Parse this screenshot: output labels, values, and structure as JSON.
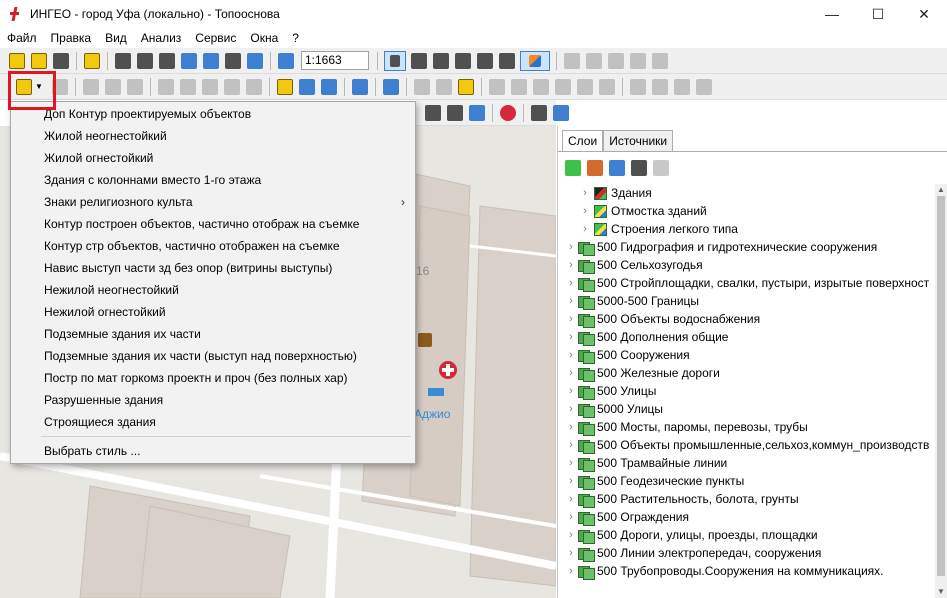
{
  "window": {
    "title": "ИНГЕО - город Уфа (локально) - Топооснова",
    "minimize": "—",
    "maximize": "☐",
    "close": "✕"
  },
  "menu": [
    "Файл",
    "Правка",
    "Вид",
    "Анализ",
    "Сервис",
    "Окна",
    "?"
  ],
  "toolbar": {
    "scale_value": "1:1663"
  },
  "dropdown": {
    "items": [
      "Доп Контур проектируемых объектов",
      "Жилой неогнестойкий",
      "Жилой огнестойкий",
      "Здания с колоннами вместо 1-го этажа",
      "Знаки религиозного культа",
      "Контур построен объектов, частично отображ на съемке",
      "Контур стр объектов, частично отображен на съемке",
      "Навис выступ части зд без опор (витрины выступы)",
      "Нежилой неогнестойкий",
      "Нежилой огнестойкий",
      "Подземные здания их части",
      "Подземные здания их части (выступ над поверхностью)",
      "Постр по мат горкомз проектн и проч (без полных хар)",
      "Разрушенные здания",
      "Строящиеся здания"
    ],
    "submenu_arrow": "›",
    "footer": "Выбрать стиль ..."
  },
  "map": {
    "house_number": "16",
    "poi_label": "Аджио"
  },
  "panel": {
    "tabs": [
      "Слои",
      "Источники"
    ],
    "active_tab": "Слои",
    "layers": [
      {
        "label": "Здания",
        "level": 1
      },
      {
        "label": "Отмостка зданий",
        "level": 1
      },
      {
        "label": "Строения легкого типа",
        "level": 1
      },
      {
        "label": "500 Гидрография и гидротехнические сооружения",
        "level": 0
      },
      {
        "label": "500 Сельхозугодья",
        "level": 0
      },
      {
        "label": "500 Стройплощадки, свалки, пустыри, изрытые поверхност",
        "level": 0
      },
      {
        "label": "5000-500 Границы",
        "level": 0
      },
      {
        "label": "500 Объекты водоснабжения",
        "level": 0
      },
      {
        "label": "500 Дополнения общие",
        "level": 0
      },
      {
        "label": "500 Сооружения",
        "level": 0
      },
      {
        "label": "500 Железные дороги",
        "level": 0
      },
      {
        "label": "500 Улицы",
        "level": 0
      },
      {
        "label": "5000 Улицы",
        "level": 0
      },
      {
        "label": "500 Мосты, паромы, перевозы, трубы",
        "level": 0
      },
      {
        "label": "500 Объекты промышленные,сельхоз,коммун_производств",
        "level": 0
      },
      {
        "label": "500 Трамвайные линии",
        "level": 0
      },
      {
        "label": "500 Геодезические пункты",
        "level": 0
      },
      {
        "label": "500 Растительность, болота, грунты",
        "level": 0
      },
      {
        "label": "500 Ограждения",
        "level": 0
      },
      {
        "label": "500 Дороги, улицы, проезды, площадки",
        "level": 0
      },
      {
        "label": "500 Линии электропередач, сооружения",
        "level": 0
      },
      {
        "label": "500 Трубопроводы.Сооружения на коммуникациях.",
        "level": 0
      }
    ]
  }
}
